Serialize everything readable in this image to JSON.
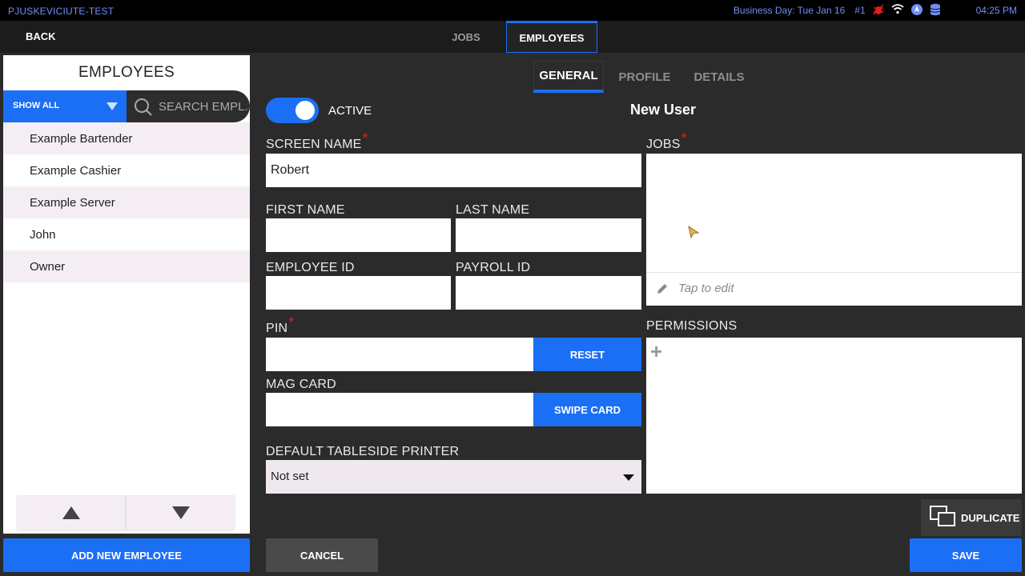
{
  "status_bar": {
    "device_name": "PJUSKEVICIUTE-TEST",
    "business_day": "Business Day: Tue Jan 16",
    "terminal_number": "#1",
    "time": "04:25 PM",
    "icons": [
      "bug-icon",
      "wifi-icon",
      "location-icon",
      "database-icon"
    ]
  },
  "top_nav": {
    "back_label": "BACK",
    "tabs": [
      {
        "label": "JOBS",
        "active": false
      },
      {
        "label": "EMPLOYEES",
        "active": true
      }
    ]
  },
  "left_panel": {
    "title": "EMPLOYEES",
    "filter_label": "SHOW ALL",
    "search_placeholder": "SEARCH EMPL...",
    "employees": [
      "Example Bartender",
      "Example Cashier",
      "Example Server",
      "John",
      "Owner"
    ],
    "add_button": "ADD NEW EMPLOYEE"
  },
  "sub_tabs": [
    {
      "label": "GENERAL",
      "active": true
    },
    {
      "label": "PROFILE",
      "active": false
    },
    {
      "label": "DETAILS",
      "active": false
    }
  ],
  "form": {
    "active_label": "ACTIVE",
    "active_on": true,
    "heading": "New User",
    "required_mark": "*",
    "screen_name_label": "SCREEN NAME",
    "screen_name_value": "Robert",
    "first_name_label": "FIRST NAME",
    "first_name_value": "",
    "last_name_label": "LAST NAME",
    "last_name_value": "",
    "employee_id_label": "EMPLOYEE ID",
    "employee_id_value": "",
    "payroll_id_label": "PAYROLL ID",
    "payroll_id_value": "",
    "pin_label": "PIN",
    "pin_value": "",
    "reset_button": "RESET",
    "mag_card_label": "MAG CARD",
    "mag_card_value": "",
    "swipe_button": "SWIPE CARD",
    "printer_label": "DEFAULT TABLESIDE PRINTER",
    "printer_value": "Not set",
    "jobs_label": "JOBS",
    "jobs_edit_hint": "Tap to edit",
    "permissions_label": "PERMISSIONS",
    "permissions_add": "+"
  },
  "footer": {
    "duplicate_button": "DUPLICATE",
    "cancel_button": "CANCEL",
    "save_button": "SAVE"
  },
  "colors": {
    "accent": "#1b6ff5",
    "background": "#2b2b2b",
    "required": "#e0201b",
    "status_text": "#6f8ff5"
  }
}
